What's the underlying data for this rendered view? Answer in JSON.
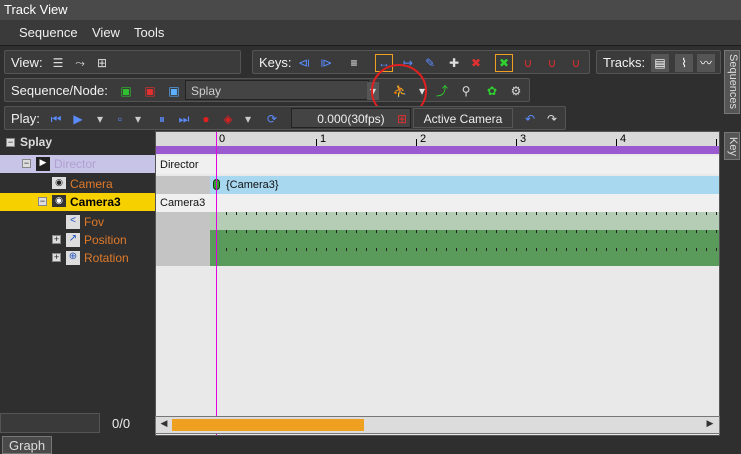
{
  "window": {
    "title": "Track View"
  },
  "menu": {
    "items": [
      "Sequence",
      "View",
      "Tools"
    ]
  },
  "toolbar": {
    "view_label": "View:",
    "keys_label": "Keys:",
    "tracks_label": "Tracks:",
    "seqnode_label": "Sequence/Node:",
    "sequence_value": "Splay",
    "play_label": "Play:",
    "time_value": "0.000(30fps)",
    "active_camera_label": "Active Camera"
  },
  "tree": {
    "root": "Splay",
    "director": "Director",
    "camera_child": "Camera",
    "camera3": "Camera3",
    "fov": "Fov",
    "position": "Position",
    "rotation": "Rotation",
    "counter": "0/0"
  },
  "timeline": {
    "ticks": [
      "0",
      "1",
      "2",
      "3",
      "4"
    ],
    "director_row": "Director",
    "camera_key": "{Camera3}",
    "camera3_row": "Camera3"
  },
  "sidetabs": {
    "sequences": "Sequences",
    "key": "Key"
  },
  "bottomtab": {
    "graph": "Graph"
  },
  "colors": {
    "accent_yellow": "#f7d000",
    "track_green": "#5a9a5a",
    "track_blue": "#a8d8f0",
    "purple": "#9b59d0",
    "cursor": "#e000e0",
    "orange": "#f0a020"
  }
}
